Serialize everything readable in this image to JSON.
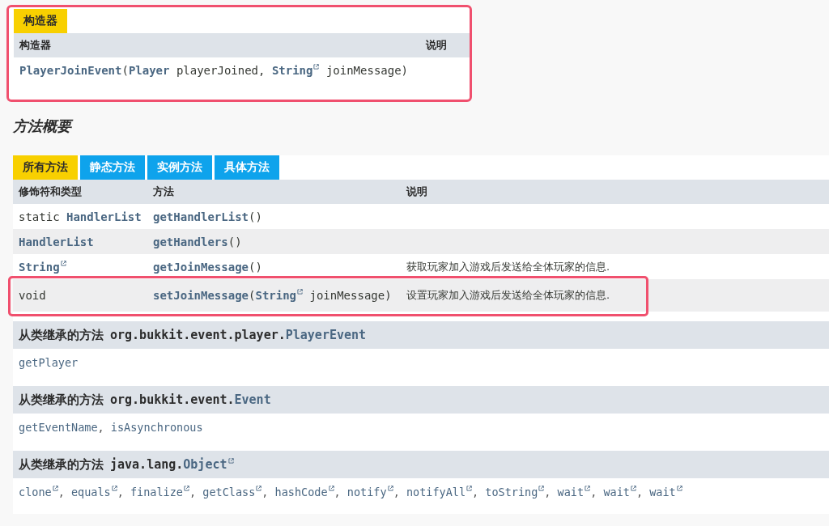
{
  "constructors": {
    "tab": "构造器",
    "highlighted": true,
    "columns": [
      "构造器",
      "说明"
    ],
    "rows": [
      {
        "signature": [
          {
            "text": "PlayerJoinEvent",
            "link": true,
            "external": false
          },
          {
            "text": "(",
            "link": false,
            "external": false
          },
          {
            "text": "Player",
            "link": true,
            "external": false
          },
          {
            "text": " playerJoined, ",
            "link": false,
            "external": false
          },
          {
            "text": "String",
            "link": true,
            "external": true
          },
          {
            "text": " joinMessage)",
            "link": false,
            "external": false
          }
        ]
      }
    ]
  },
  "method_summary": {
    "title": "方法概要",
    "tabs": [
      {
        "label": "所有方法",
        "selected": true
      },
      {
        "label": "静态方法",
        "selected": false
      },
      {
        "label": "实例方法",
        "selected": false
      },
      {
        "label": "具体方法",
        "selected": false
      }
    ],
    "columns": [
      "修饰符和类型",
      "方法",
      "说明"
    ],
    "rows": [
      {
        "highlighted": false,
        "modifier": [
          {
            "text": "static ",
            "link": false,
            "external": false
          },
          {
            "text": "HandlerList",
            "link": true,
            "external": false
          }
        ],
        "method": [
          {
            "text": "getHandlerList",
            "link": true,
            "external": false
          },
          {
            "text": "()",
            "link": false,
            "external": false
          }
        ]
      },
      {
        "highlighted": false,
        "modifier": [
          {
            "text": "HandlerList",
            "link": true,
            "external": false
          }
        ],
        "method": [
          {
            "text": "getHandlers",
            "link": true,
            "external": false
          },
          {
            "text": "()",
            "link": false,
            "external": false
          }
        ]
      },
      {
        "highlighted": false,
        "modifier": [
          {
            "text": "String",
            "link": true,
            "external": true
          }
        ],
        "method": [
          {
            "text": "getJoinMessage",
            "link": true,
            "external": false
          },
          {
            "text": "()",
            "link": false,
            "external": false
          }
        ],
        "description": "获取玩家加入游戏后发送给全体玩家的信息."
      },
      {
        "highlighted": true,
        "modifier": [
          {
            "text": "void",
            "link": false,
            "external": false
          }
        ],
        "method": [
          {
            "text": "setJoinMessage",
            "link": true,
            "external": false
          },
          {
            "text": "(",
            "link": false,
            "external": false
          },
          {
            "text": "String",
            "link": true,
            "external": true
          },
          {
            "text": " joinMessage)",
            "link": false,
            "external": false
          }
        ],
        "description": "设置玩家加入游戏后发送给全体玩家的信息."
      }
    ]
  },
  "inherited_separator": ", ",
  "inherited": [
    {
      "label": "从类继承的方法",
      "package": "org.bukkit.event.player.",
      "class_name": "PlayerEvent",
      "external": false,
      "methods": [
        {
          "text": "getPlayer",
          "external": false
        }
      ]
    },
    {
      "label": "从类继承的方法",
      "package": "org.bukkit.event.",
      "class_name": "Event",
      "external": false,
      "methods": [
        {
          "text": "getEventName",
          "external": false
        },
        {
          "text": "isAsynchronous",
          "external": false
        }
      ]
    },
    {
      "label": "从类继承的方法",
      "package": "java.lang.",
      "class_name": "Object",
      "external": true,
      "methods": [
        {
          "text": "clone",
          "external": true
        },
        {
          "text": "equals",
          "external": true
        },
        {
          "text": "finalize",
          "external": true
        },
        {
          "text": "getClass",
          "external": true
        },
        {
          "text": "hashCode",
          "external": true
        },
        {
          "text": "notify",
          "external": true
        },
        {
          "text": "notifyAll",
          "external": true
        },
        {
          "text": "toString",
          "external": true
        },
        {
          "text": "wait",
          "external": true
        },
        {
          "text": "wait",
          "external": true
        },
        {
          "text": "wait",
          "external": true
        }
      ]
    }
  ]
}
